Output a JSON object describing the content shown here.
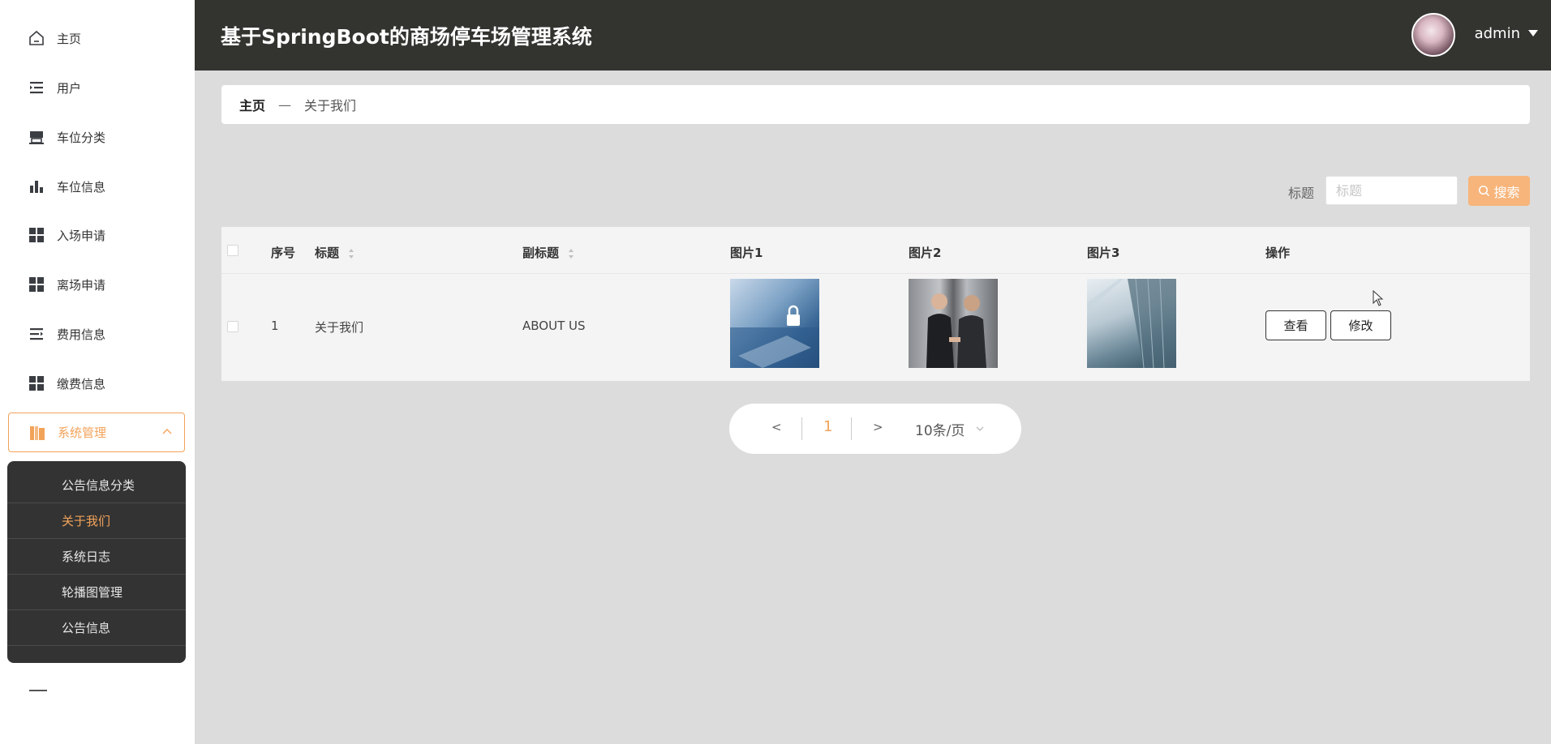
{
  "header": {
    "title": "基于SpringBoot的商场停车场管理系统",
    "user": "admin"
  },
  "sidebar": {
    "items": [
      {
        "label": "主页",
        "icon": "home-icon"
      },
      {
        "label": "用户",
        "icon": "list-indent-icon"
      },
      {
        "label": "车位分类",
        "icon": "shop-icon"
      },
      {
        "label": "车位信息",
        "icon": "bar-chart-icon"
      },
      {
        "label": "入场申请",
        "icon": "grid-icon"
      },
      {
        "label": "离场申请",
        "icon": "grid-icon"
      },
      {
        "label": "费用信息",
        "icon": "list-arrow-icon"
      },
      {
        "label": "缴费信息",
        "icon": "grid-icon"
      },
      {
        "label": "系统管理",
        "icon": "books-icon"
      }
    ],
    "submenu": [
      "公告信息分类",
      "关于我们",
      "系统日志",
      "轮播图管理",
      "公告信息"
    ]
  },
  "breadcrumb": {
    "home": "主页",
    "separator": "—",
    "current": "关于我们"
  },
  "search": {
    "label": "标题",
    "placeholder": "标题",
    "button": "搜索"
  },
  "table": {
    "headers": {
      "index": "序号",
      "title": "标题",
      "subtitle": "副标题",
      "image1": "图片1",
      "image2": "图片2",
      "image3": "图片3",
      "actions": "操作"
    },
    "rows": [
      {
        "index": "1",
        "title": "关于我们",
        "subtitle": "ABOUT US",
        "view": "查看",
        "edit": "修改"
      }
    ]
  },
  "pagination": {
    "prev": "<",
    "next": ">",
    "current": "1",
    "page_size": "10条/页"
  },
  "colors": {
    "accent": "#f2a35a",
    "header_bg": "#333330",
    "page_bg": "#dcdcdc"
  }
}
